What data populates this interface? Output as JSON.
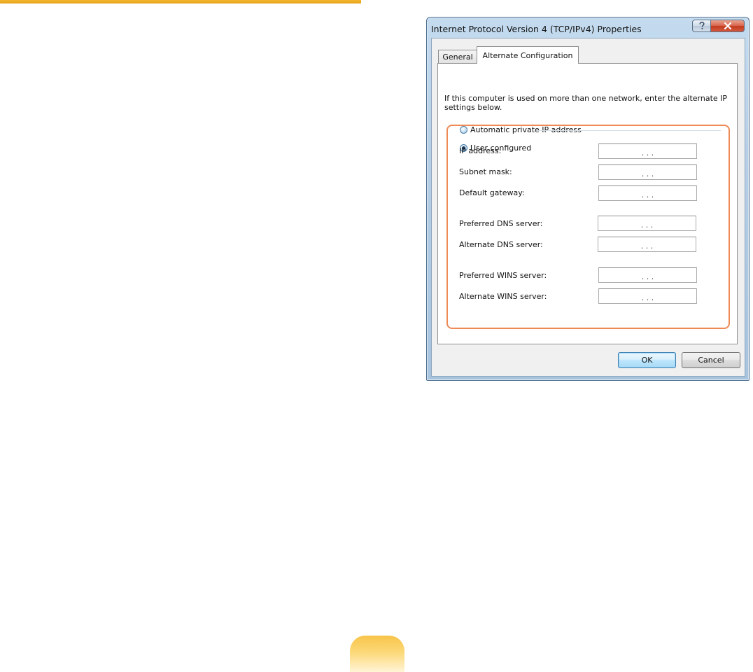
{
  "dialog": {
    "title": "Internet Protocol Version 4 (TCP/IPv4) Properties",
    "help_button": "?",
    "close_button": "x"
  },
  "tabs": [
    {
      "label": "General",
      "active": false
    },
    {
      "label": "Alternate Configuration",
      "active": true
    }
  ],
  "intro_text": "If this computer is used on more than one network, enter the alternate IP settings below.",
  "options": {
    "automatic": {
      "label": "Automatic private IP address",
      "selected": false
    },
    "user_configured": {
      "label": "User configured",
      "selected": true
    }
  },
  "fields": {
    "ip_address": {
      "label": "IP address:",
      "value": "",
      "separators": ".   .   ."
    },
    "subnet_mask": {
      "label": "Subnet mask:",
      "value": "",
      "separators": ".   .   ."
    },
    "default_gateway": {
      "label": "Default gateway:",
      "value": "",
      "separators": ".   .   ."
    },
    "preferred_dns": {
      "label": "Preferred DNS server:",
      "value": "",
      "separators": ".   .   ."
    },
    "alternate_dns": {
      "label": "Alternate DNS server:",
      "value": "",
      "separators": ".   .   ."
    },
    "preferred_wins": {
      "label": "Preferred WINS server:",
      "value": "",
      "separators": ".   .   ."
    },
    "alternate_wins": {
      "label": "Alternate WINS server:",
      "value": "",
      "separators": ".   .   ."
    }
  },
  "buttons": {
    "ok": "OK",
    "cancel": "Cancel"
  },
  "colors": {
    "highlight": "#ee8a55",
    "page_accent": "#f2b62e"
  }
}
